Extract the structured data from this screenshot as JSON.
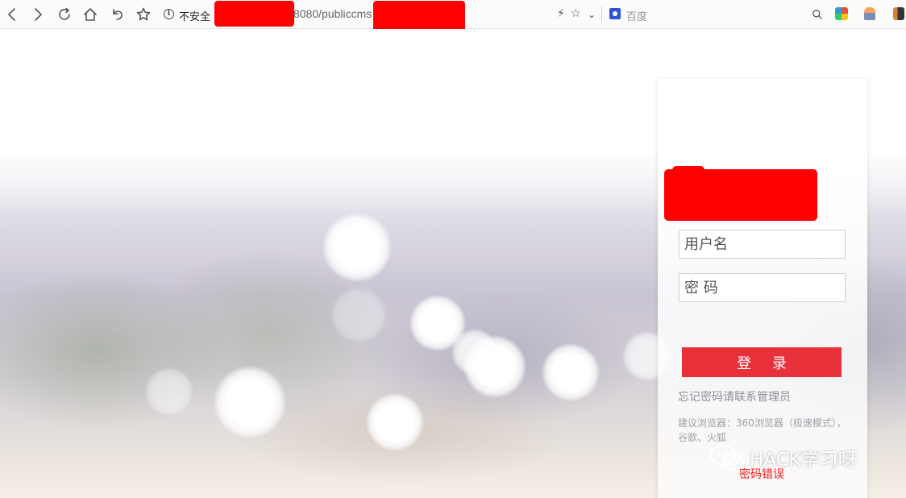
{
  "browser": {
    "security_label": "不安全",
    "url_visible_fragment": "8080/publiccms",
    "search_engine_label": "百度",
    "icons": {
      "back": "arrow-left-icon",
      "forward": "arrow-right-icon",
      "reload": "reload-icon",
      "home": "home-icon",
      "undo": "undo-icon",
      "bookmark": "star-icon",
      "info": "info-icon",
      "lightning": "lightning-icon",
      "addr_star": "star-icon",
      "dropdown": "chevron-down-icon",
      "search": "search-icon"
    }
  },
  "login": {
    "username_placeholder": "用户名",
    "password_placeholder": "密 码",
    "submit_label": "登 录",
    "forgot_text": "忘记密码请联系管理员",
    "browser_hint": "建议浏览器：360浏览器（极速模式），谷歌、火狐",
    "error_text": "密码错误"
  },
  "watermark": {
    "text": "HACK学习呀"
  },
  "colors": {
    "login_button": "#e8303b",
    "error_text": "#f02020",
    "redaction": "#ff0000"
  }
}
